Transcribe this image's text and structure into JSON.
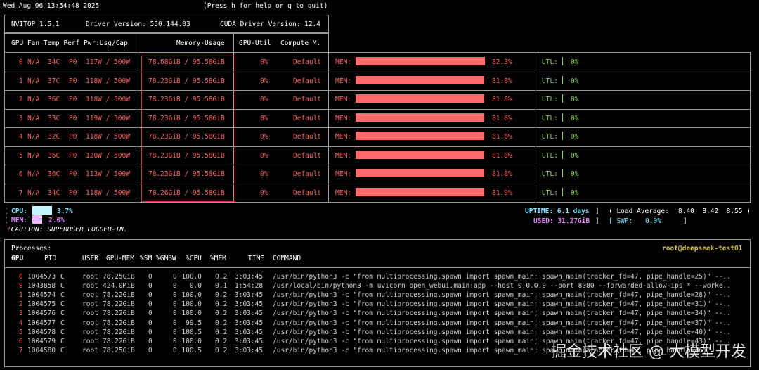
{
  "header": {
    "datetime": "Wed Aug 06 13:54:48 2025",
    "help_text": "(Press h for help or q to quit)"
  },
  "info": {
    "nvitop": "NVITOP 1.5.1",
    "driver": "Driver Version: 550.144.03",
    "cuda": "CUDA Driver Version: 12.4"
  },
  "gpu_header": {
    "left": "GPU Fan Temp Perf Pwr:Usg/Cap",
    "mem": "Memory-Usage",
    "util": "GPU-Util",
    "compute": "Compute M."
  },
  "gpus": [
    {
      "id": "0",
      "fan": "N/A",
      "temp": "34C",
      "perf": "P0",
      "pwr": "117W / 500W",
      "mem": "78.68GiB / 95.58GiB",
      "util": "0%",
      "mode": "Default",
      "mem_label": "MEM:",
      "mem_pct": "82.3%",
      "mem_frac": 0.823,
      "utl_label": "UTL:",
      "utl_pct": "0%"
    },
    {
      "id": "1",
      "fan": "N/A",
      "temp": "37C",
      "perf": "P0",
      "pwr": "118W / 500W",
      "mem": "78.23GiB / 95.58GiB",
      "util": "0%",
      "mode": "Default",
      "mem_label": "MEM:",
      "mem_pct": "81.8%",
      "mem_frac": 0.818,
      "utl_label": "UTL:",
      "utl_pct": "0%"
    },
    {
      "id": "2",
      "fan": "N/A",
      "temp": "36C",
      "perf": "P0",
      "pwr": "118W / 500W",
      "mem": "78.23GiB / 95.58GiB",
      "util": "0%",
      "mode": "Default",
      "mem_label": "MEM:",
      "mem_pct": "81.8%",
      "mem_frac": 0.818,
      "utl_label": "UTL:",
      "utl_pct": "0%"
    },
    {
      "id": "3",
      "fan": "N/A",
      "temp": "33C",
      "perf": "P0",
      "pwr": "119W / 500W",
      "mem": "78.23GiB / 95.58GiB",
      "util": "0%",
      "mode": "Default",
      "mem_label": "MEM:",
      "mem_pct": "81.8%",
      "mem_frac": 0.818,
      "utl_label": "UTL:",
      "utl_pct": "0%"
    },
    {
      "id": "4",
      "fan": "N/A",
      "temp": "32C",
      "perf": "P0",
      "pwr": "118W / 500W",
      "mem": "78.23GiB / 95.58GiB",
      "util": "0%",
      "mode": "Default",
      "mem_label": "MEM:",
      "mem_pct": "81.8%",
      "mem_frac": 0.818,
      "utl_label": "UTL:",
      "utl_pct": "0%"
    },
    {
      "id": "5",
      "fan": "N/A",
      "temp": "36C",
      "perf": "P0",
      "pwr": "120W / 500W",
      "mem": "78.23GiB / 95.58GiB",
      "util": "0%",
      "mode": "Default",
      "mem_label": "MEM:",
      "mem_pct": "81.8%",
      "mem_frac": 0.818,
      "utl_label": "UTL:",
      "utl_pct": "0%"
    },
    {
      "id": "6",
      "fan": "N/A",
      "temp": "36C",
      "perf": "P0",
      "pwr": "113W / 500W",
      "mem": "78.23GiB / 95.58GiB",
      "util": "0%",
      "mode": "Default",
      "mem_label": "MEM:",
      "mem_pct": "81.8%",
      "mem_frac": 0.818,
      "utl_label": "UTL:",
      "utl_pct": "0%"
    },
    {
      "id": "7",
      "fan": "N/A",
      "temp": "34C",
      "perf": "P0",
      "pwr": "118W / 500W",
      "mem": "78.26GiB / 95.58GiB",
      "util": "0%",
      "mode": "Default",
      "mem_label": "MEM:",
      "mem_pct": "81.9%",
      "mem_frac": 0.819,
      "utl_label": "UTL:",
      "utl_pct": "0%"
    }
  ],
  "system": {
    "cpu_label": "CPU:",
    "cpu_pct": "3.7%",
    "cpu_frac": 0.037,
    "mem_label": "MEM:",
    "mem_pct": "2.0%",
    "mem_frac": 0.02,
    "uptime": "UPTIME: 6.1 days",
    "load_label": "( Load Average:",
    "load_values": "8.40  8.42  8.55 )",
    "used": "USED: 31.27GiB",
    "swp_label": "[ SWP:",
    "swp_value": "0.0%",
    "caution": "CAUTION: SUPERUSER LOGGED-IN."
  },
  "processes": {
    "title": "Processes:",
    "host": "root@deepseek-test01",
    "headers": {
      "gpu": "GPU",
      "pid": "PID",
      "user": "USER",
      "gpumem": "GPU-MEM",
      "sm": "%SM",
      "gmbw": "%GMBW",
      "cpu": "%CPU",
      "mem": "%MEM",
      "time": "TIME",
      "command": "COMMAND"
    },
    "rows": [
      {
        "gpu": "0",
        "pid": "1004573",
        "type": "C",
        "user": "root",
        "gpumem": "78.25GiB",
        "sm": "0",
        "gmbw": "0",
        "cpu": "100.0",
        "mem": "0.2",
        "time": "3:03:45",
        "command": "/usr/bin/python3 -c \"from multiprocessing.spawn import spawn_main; spawn_main(tracker_fd=47, pipe_handle=25)\" --.."
      },
      {
        "gpu": "0",
        "pid": "1043858",
        "type": "C",
        "user": "root",
        "gpumem": "424.0MiB",
        "sm": "0",
        "gmbw": "0",
        "cpu": "0.0",
        "mem": "0.1",
        "time": "1:54:28",
        "command": "/usr/local/bin/python3 -m uvicorn open_webui.main:app --host 0.0.0.0 --port 8080 --forwarded-allow-ips * --worke.."
      },
      {
        "gpu": "1",
        "pid": "1004574",
        "type": "C",
        "user": "root",
        "gpumem": "78.22GiB",
        "sm": "0",
        "gmbw": "0",
        "cpu": "100.0",
        "mem": "0.2",
        "time": "3:03:45",
        "command": "/usr/bin/python3 -c \"from multiprocessing.spawn import spawn_main; spawn_main(tracker_fd=47, pipe_handle=28)\" --.."
      },
      {
        "gpu": "2",
        "pid": "1004575",
        "type": "C",
        "user": "root",
        "gpumem": "78.22GiB",
        "sm": "0",
        "gmbw": "0",
        "cpu": "100.0",
        "mem": "0.2",
        "time": "3:03:45",
        "command": "/usr/bin/python3 -c \"from multiprocessing.spawn import spawn_main; spawn_main(tracker_fd=47, pipe_handle=31)\" --.."
      },
      {
        "gpu": "3",
        "pid": "1004576",
        "type": "C",
        "user": "root",
        "gpumem": "78.22GiB",
        "sm": "0",
        "gmbw": "0",
        "cpu": "100.0",
        "mem": "0.2",
        "time": "3:03:45",
        "command": "/usr/bin/python3 -c \"from multiprocessing.spawn import spawn_main; spawn_main(tracker_fd=47, pipe_handle=34)\" --.."
      },
      {
        "gpu": "4",
        "pid": "1004577",
        "type": "C",
        "user": "root",
        "gpumem": "78.22GiB",
        "sm": "0",
        "gmbw": "0",
        "cpu": "99.5",
        "mem": "0.2",
        "time": "3:03:45",
        "command": "/usr/bin/python3 -c \"from multiprocessing.spawn import spawn_main; spawn_main(tracker_fd=47, pipe_handle=37)\" --.."
      },
      {
        "gpu": "5",
        "pid": "1004578",
        "type": "C",
        "user": "root",
        "gpumem": "78.22GiB",
        "sm": "0",
        "gmbw": "0",
        "cpu": "100.5",
        "mem": "0.2",
        "time": "3:03:45",
        "command": "/usr/bin/python3 -c \"from multiprocessing.spawn import spawn_main; spawn_main(tracker_fd=47, pipe_handle=40)\" --.."
      },
      {
        "gpu": "6",
        "pid": "1004579",
        "type": "C",
        "user": "root",
        "gpumem": "78.22GiB",
        "sm": "0",
        "gmbw": "0",
        "cpu": "100.0",
        "mem": "0.2",
        "time": "3:03:45",
        "command": "/usr/bin/python3 -c \"from multiprocessing.spawn import spawn_main; spawn_main(tracker_fd=47, pipe_handle=43)\" --.."
      },
      {
        "gpu": "7",
        "pid": "1004580",
        "type": "C",
        "user": "root",
        "gpumem": "78.25GiB",
        "sm": "0",
        "gmbw": "0",
        "cpu": "100.5",
        "mem": "0.2",
        "time": "3:03:45",
        "command": "/usr/bin/python3 -c \"from multiprocessing.spawn import spawn_main; spawn_main(tracker_fd=47, pipe_handle=46)\" --.."
      }
    ]
  },
  "watermark": "掘金技术社区 @ 大模型开发"
}
